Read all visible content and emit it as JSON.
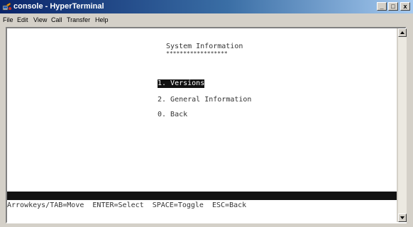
{
  "window": {
    "title": "console - HyperTerminal",
    "minimize_glyph": "_",
    "maximize_glyph": "□",
    "close_glyph": "x"
  },
  "menu": {
    "items": [
      "File",
      "Edit",
      "View",
      "Call",
      "Transfer",
      "Help"
    ]
  },
  "terminal": {
    "heading": "System Information",
    "heading_underline": "******************",
    "options": [
      {
        "label": "1. Versions",
        "selected": true
      },
      {
        "label": "2. General Information",
        "selected": false
      },
      {
        "label": "0. Back",
        "selected": false
      }
    ],
    "status_line": "Arrowkeys/TAB=Move  ENTER=Select  SPACE=Toggle  ESC=Back"
  },
  "colors": {
    "title_gradient_start": "#0a246a",
    "title_gradient_end": "#a6caf0",
    "terminal_background": "#ffffff",
    "terminal_text": "#333333",
    "selection_bar": "#111111"
  },
  "icons": {
    "app_icon": "hyperterminal-icon",
    "scroll_up": "up-arrow-icon",
    "scroll_down": "down-arrow-icon"
  }
}
